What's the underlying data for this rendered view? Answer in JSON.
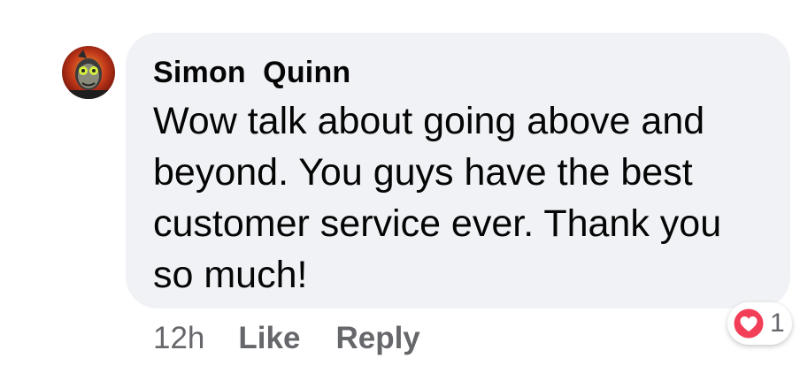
{
  "comment": {
    "author": "Simon  Quinn",
    "text_lines": [
      "Wow talk about going above and",
      "beyond. You guys have the best",
      "customer service ever. Thank you",
      "so much!"
    ],
    "timestamp": "12h",
    "like_label": "Like",
    "reply_label": "Reply",
    "reaction_count": "1",
    "reaction_icon": "heart-icon",
    "avatar_icon": "avatar-image"
  },
  "colors": {
    "bubble": "#f0f2f5",
    "text": "#050505",
    "secondary_text": "#65676b",
    "heart": "#f33e58"
  }
}
